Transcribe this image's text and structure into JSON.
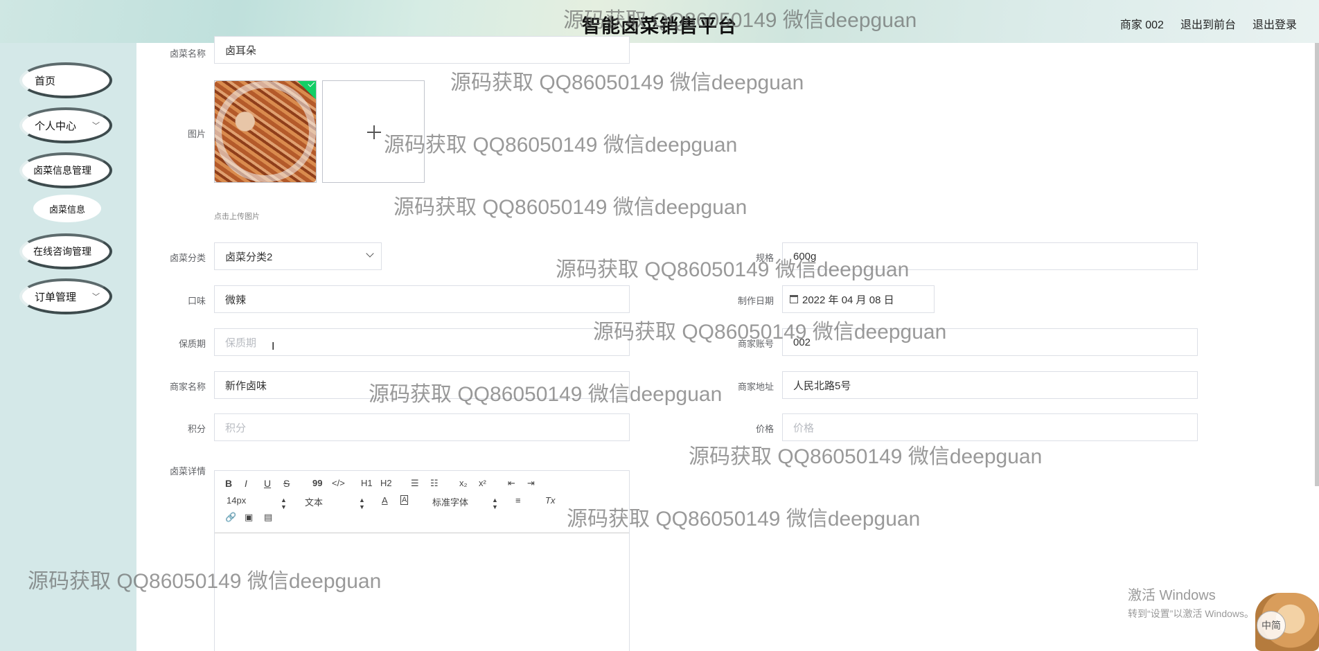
{
  "header": {
    "title": "智能卤菜销售平台",
    "nav": {
      "user": "商家 002",
      "front": "退出到前台",
      "logout": "退出登录"
    }
  },
  "sidebar": {
    "items": [
      {
        "label": "首页"
      },
      {
        "label": "个人中心"
      },
      {
        "label": "卤菜信息管理"
      },
      {
        "label": "卤菜信息"
      },
      {
        "label": "在线咨询管理"
      },
      {
        "label": "订单管理"
      }
    ]
  },
  "form": {
    "name": {
      "label": "卤菜名称",
      "value": "卤耳朵"
    },
    "image": {
      "label": "图片",
      "tip": "点击上传图片"
    },
    "category": {
      "label": "卤菜分类",
      "value": "卤菜分类2"
    },
    "spec": {
      "label": "规格",
      "value": "600g"
    },
    "taste": {
      "label": "口味",
      "value": "微辣"
    },
    "date": {
      "label": "制作日期",
      "value": "2022 年 04 月 08 日"
    },
    "shelf": {
      "label": "保质期",
      "placeholder": "保质期"
    },
    "merchant_account": {
      "label": "商家账号",
      "value": "002"
    },
    "merchant_name": {
      "label": "商家名称",
      "value": "新作卤味"
    },
    "merchant_addr": {
      "label": "商家地址",
      "value": "人民北路5号"
    },
    "points": {
      "label": "积分",
      "placeholder": "积分"
    },
    "price": {
      "label": "价格",
      "placeholder": "价格"
    },
    "detail": {
      "label": "卤菜详情"
    }
  },
  "editor": {
    "font_size": "14px",
    "header_select": "文本",
    "font_family": "标准字体",
    "h1": "H1",
    "h2": "H2",
    "sub": "x₂",
    "sup": "x²",
    "quote": "99",
    "code": "</>",
    "bold": "B",
    "italic": "I",
    "underline": "U",
    "strike": "S",
    "font_color": "A",
    "bg_color": "A",
    "clean": "Tx"
  },
  "watermark": "源码获取 QQ86050149 微信deepguan",
  "windows": {
    "line1": "激活 Windows",
    "line2": "转到“设置”以激活 Windows。"
  },
  "ime": "中简"
}
